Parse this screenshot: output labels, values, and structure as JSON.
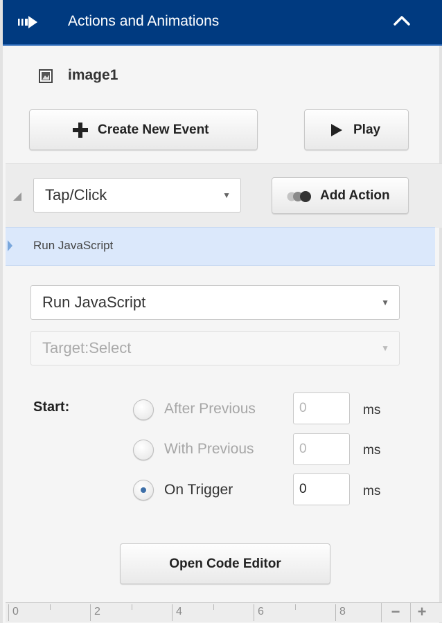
{
  "header": {
    "title": "Actions and Animations"
  },
  "element": {
    "name": "image1"
  },
  "toolbar": {
    "create_event_label": "Create New Event",
    "play_label": "Play"
  },
  "event": {
    "trigger_value": "Tap/Click",
    "add_action_label": "Add Action"
  },
  "action_list": {
    "items": [
      {
        "label": "Run JavaScript"
      }
    ]
  },
  "action_settings": {
    "action_type_value": "Run JavaScript",
    "target_value": "Target:Select",
    "start_label": "Start:",
    "options": [
      {
        "label": "After Previous",
        "value": "0",
        "unit": "ms",
        "selected": false
      },
      {
        "label": "With Previous",
        "value": "0",
        "unit": "ms",
        "selected": false
      },
      {
        "label": "On Trigger",
        "value": "0",
        "unit": "ms",
        "selected": true
      }
    ],
    "open_editor_label": "Open Code Editor"
  },
  "timeline": {
    "labels": [
      "0",
      "2",
      "4",
      "6",
      "8"
    ],
    "zoom_out_label": "−",
    "zoom_in_label": "+"
  },
  "colors": {
    "header_bg": "#003a80",
    "selected_row_bg": "#dbe8fb",
    "radio_dot": "#3d6fa8"
  }
}
